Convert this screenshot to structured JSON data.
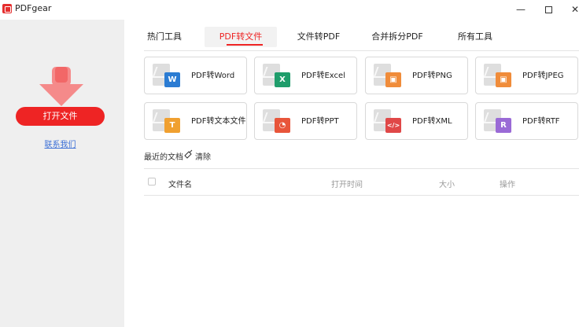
{
  "window": {
    "title": "PDFgear",
    "minimize": "—",
    "close": "✕"
  },
  "sidebar": {
    "open_button": "打开文件",
    "contact_link": "联系我们"
  },
  "tabs": [
    {
      "label": "热门工具",
      "active": false
    },
    {
      "label": "PDF转文件",
      "active": true
    },
    {
      "label": "文件转PDF",
      "active": false
    },
    {
      "label": "合并拆分PDF",
      "active": false
    },
    {
      "label": "所有工具",
      "active": false
    }
  ],
  "tools": [
    {
      "label": "PDF转Word",
      "badge": "W",
      "icon": "word-icon",
      "color": "#2b7cd3"
    },
    {
      "label": "PDF转Excel",
      "badge": "X",
      "icon": "excel-icon",
      "color": "#1f9d6b"
    },
    {
      "label": "PDF转PNG",
      "badge": "▣",
      "icon": "png-icon",
      "color": "#f08c3a"
    },
    {
      "label": "PDF转JPEG",
      "badge": "▣",
      "icon": "jpeg-icon",
      "color": "#f08c3a"
    },
    {
      "label": "PDF转文本文件",
      "badge": "T",
      "icon": "text-icon",
      "color": "#f0a030"
    },
    {
      "label": "PDF转PPT",
      "badge": "◔",
      "icon": "ppt-icon",
      "color": "#e8553a"
    },
    {
      "label": "PDF转XML",
      "badge": "</>",
      "icon": "xml-icon",
      "color": "#e04848"
    },
    {
      "label": "PDF转RTF",
      "badge": "R",
      "icon": "rtf-icon",
      "color": "#9a6ad6"
    }
  ],
  "recent": {
    "title": "最近的文档",
    "clear": "清除",
    "columns": [
      "文件名",
      "打开时间",
      "大小",
      "操作"
    ]
  },
  "colors": {
    "accent": "#ee2424",
    "drop_arrow": "#f58a8a",
    "link": "#3b6fd6"
  }
}
